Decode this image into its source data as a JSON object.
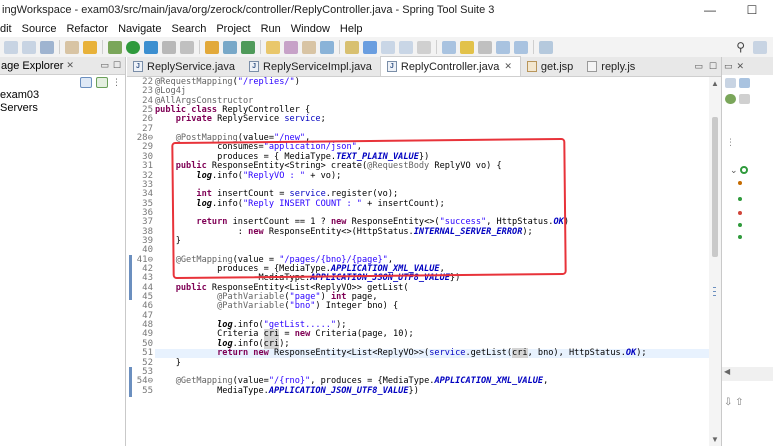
{
  "window": {
    "title": "ingWorkspace - exam03/src/main/java/org/zerock/controller/ReplyController.java - Spring Tool Suite 3",
    "minimize": "—",
    "maximize": "☐"
  },
  "menu": [
    "dit",
    "Source",
    "Refactor",
    "Navigate",
    "Search",
    "Project",
    "Run",
    "Window",
    "Help"
  ],
  "package_explorer": {
    "tab_label": "age Explorer",
    "tree": [
      "exam03",
      "Servers"
    ]
  },
  "editor": {
    "tabs": [
      {
        "label": "ReplyService.java",
        "icon": "J",
        "active": false
      },
      {
        "label": "ReplyServiceImpl.java",
        "icon": "J",
        "active": false
      },
      {
        "label": "ReplyController.java",
        "icon": "J",
        "active": true
      },
      {
        "label": "get.jsp",
        "icon": "",
        "active": false
      },
      {
        "label": "reply.js",
        "icon": "",
        "active": false
      }
    ],
    "highlighted_line": 51,
    "lines": [
      {
        "n": "22",
        "html": "<span class='ann'>@RequestMapping</span>(<span class='str'>\"/replies/\"</span>)"
      },
      {
        "n": "23",
        "html": "<span class='ann'>@Log4j</span>"
      },
      {
        "n": "24",
        "html": "<span class='ann'>@AllArgsConstructor</span>"
      },
      {
        "n": "25",
        "html": "<span class='kw'>public class</span> ReplyController {"
      },
      {
        "n": "26",
        "html": "    <span class='kw'>private</span> ReplyService <span class='fld'>service</span>;"
      },
      {
        "n": "27",
        "html": ""
      },
      {
        "n": "28⊖",
        "html": "    <span class='ann'>@PostMapping</span>(value=<span class='str'>\"/new\"</span>,"
      },
      {
        "n": "29",
        "html": "            consumes=<span class='str'>\"application/json\"</span>,"
      },
      {
        "n": "30",
        "html": "            produces = { MediaType.<span class='cst'>TEXT_PLAIN_VALUE</span>})"
      },
      {
        "n": "31",
        "html": "    <span class='kw'>public</span> ResponseEntity&lt;String&gt; create(<span class='ann'>@RequestBody</span> ReplyVO vo) {"
      },
      {
        "n": "32",
        "html": "        <span class='itb'>log</span>.info(<span class='str'>\"ReplyVO : \"</span> + vo);"
      },
      {
        "n": "33",
        "html": ""
      },
      {
        "n": "34",
        "html": "        <span class='kw'>int</span> insertCount = <span class='fld'>service</span>.register(vo);"
      },
      {
        "n": "35",
        "html": "        <span class='itb'>log</span>.info(<span class='str'>\"Reply INSERT COUNT : \"</span> + insertCount);"
      },
      {
        "n": "36",
        "html": ""
      },
      {
        "n": "37",
        "html": "        <span class='kw'>return</span> insertCount == 1 ? <span class='kw'>new</span> ResponseEntity&lt;&gt;(<span class='str'>\"success\"</span>, HttpStatus.<span class='cst'>OK</span>)"
      },
      {
        "n": "38",
        "html": "                : <span class='kw'>new</span> ResponseEntity&lt;&gt;(HttpStatus.<span class='cst'>INTERNAL_SERVER_ERROR</span>);"
      },
      {
        "n": "39",
        "html": "    }"
      },
      {
        "n": "40",
        "html": ""
      },
      {
        "n": "41⊖",
        "html": "    <span class='ann'>@GetMapping</span>(value = <span class='str'>\"/pages/{bno}/{page}\"</span>,"
      },
      {
        "n": "42",
        "html": "            produces = {MediaType.<span class='cst'>APPLICATION_XML_VALUE</span>,"
      },
      {
        "n": "43",
        "html": "                    MediaType.<span class='cst'>APPLICATION_JSON_UTF8_VALUE</span>})"
      },
      {
        "n": "44",
        "html": "    <span class='kw'>public</span> ResponseEntity&lt;List&lt;ReplyVO&gt;&gt; getList("
      },
      {
        "n": "45",
        "html": "            <span class='ann'>@PathVariable</span>(<span class='str'>\"page\"</span>) <span class='kw'>int</span> page,"
      },
      {
        "n": "46",
        "html": "            <span class='ann'>@PathVariable</span>(<span class='str'>\"bno\"</span>) Integer bno) {"
      },
      {
        "n": "47",
        "html": ""
      },
      {
        "n": "48",
        "html": "            <span class='itb'>log</span>.info(<span class='str'>\"getList.....\"</span>);"
      },
      {
        "n": "49",
        "html": "            Criteria <span class='occ'>cri</span> = <span class='kw'>new</span> Criteria(page, 10);"
      },
      {
        "n": "50",
        "html": "            <span class='itb'>log</span>.info(<span class='occ'>cri</span>);"
      },
      {
        "n": "51",
        "html": "            <span class='kw'>return new</span> ResponseEntity&lt;List&lt;ReplyVO&gt;&gt;(<span class='fld'>service</span>.getList(<span class='occ'>cri</span>, bno), HttpStatus.<span class='cst'>OK</span>);"
      },
      {
        "n": "52",
        "html": "    }"
      },
      {
        "n": "53",
        "html": ""
      },
      {
        "n": "54⊖",
        "html": "    <span class='ann'>@GetMapping</span>(value=<span class='str'>\"/{rno}\"</span>, produces = {MediaType.<span class='cst'>APPLICATION_XML_VALUE</span>,"
      },
      {
        "n": "55",
        "html": "            MediaType.<span class='cst'>APPLICATION_JSON_UTF8_VALUE</span>})"
      }
    ]
  },
  "colors": {
    "annotation_box": "#e8333a",
    "keyword": "#7f0055",
    "string": "#2a00ff",
    "field": "#0000c0",
    "line_highlight": "#e8f2fe"
  }
}
